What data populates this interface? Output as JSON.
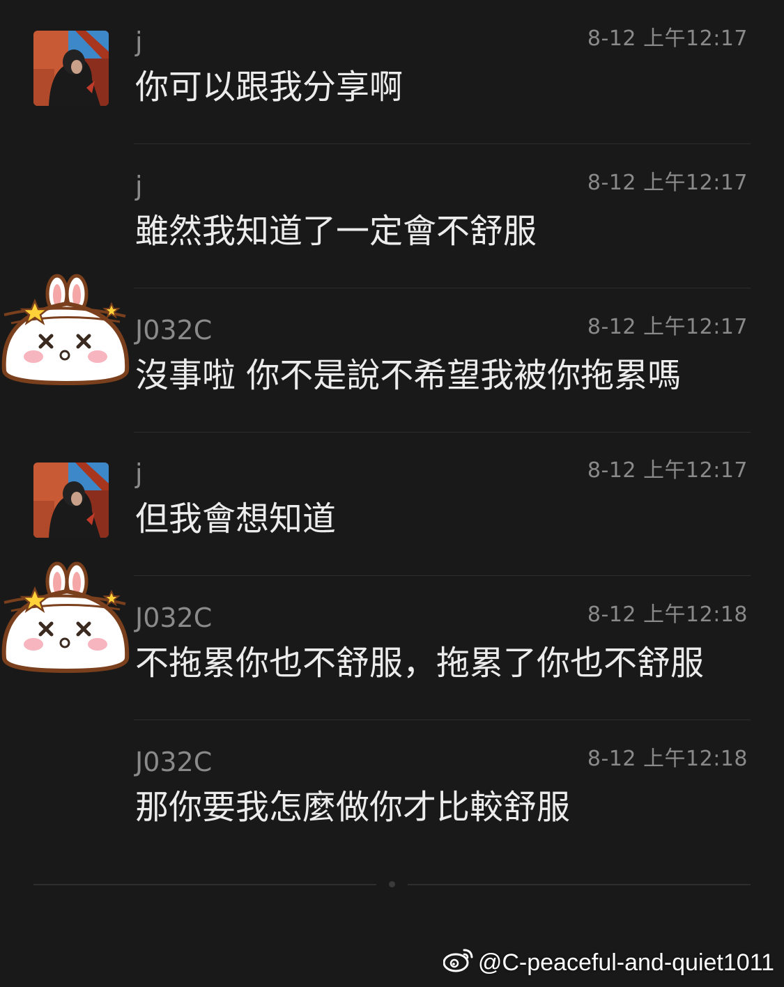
{
  "messages": [
    {
      "sender": "j",
      "time": "8-12 上午12:17",
      "text": "你可以跟我分享啊",
      "avatar": "photo-avatar"
    },
    {
      "sender": "j",
      "time": "8-12 上午12:17",
      "text": "雖然我知道了一定會不舒服",
      "avatar": ""
    },
    {
      "sender": "J032C",
      "time": "8-12 上午12:17",
      "text": "沒事啦 你不是說不希望我被你拖累嗎",
      "avatar": "bunny-avatar"
    },
    {
      "sender": "j",
      "time": "8-12 上午12:17",
      "text": "但我會想知道",
      "avatar": "photo-avatar"
    },
    {
      "sender": "J032C",
      "time": "8-12 上午12:18",
      "text": "不拖累你也不舒服，拖累了你也不舒服",
      "avatar": "bunny-avatar"
    },
    {
      "sender": "J032C",
      "time": "8-12 上午12:18",
      "text": "那你要我怎麼做你才比較舒服",
      "avatar": ""
    }
  ],
  "watermark": {
    "text": "@C-peaceful-and-quiet1011",
    "icon": "weibo-icon"
  },
  "colors": {
    "background": "#191919",
    "separator": "#2e2e2e",
    "meta_text": "#8a8a8a",
    "message_text": "#ececec"
  }
}
